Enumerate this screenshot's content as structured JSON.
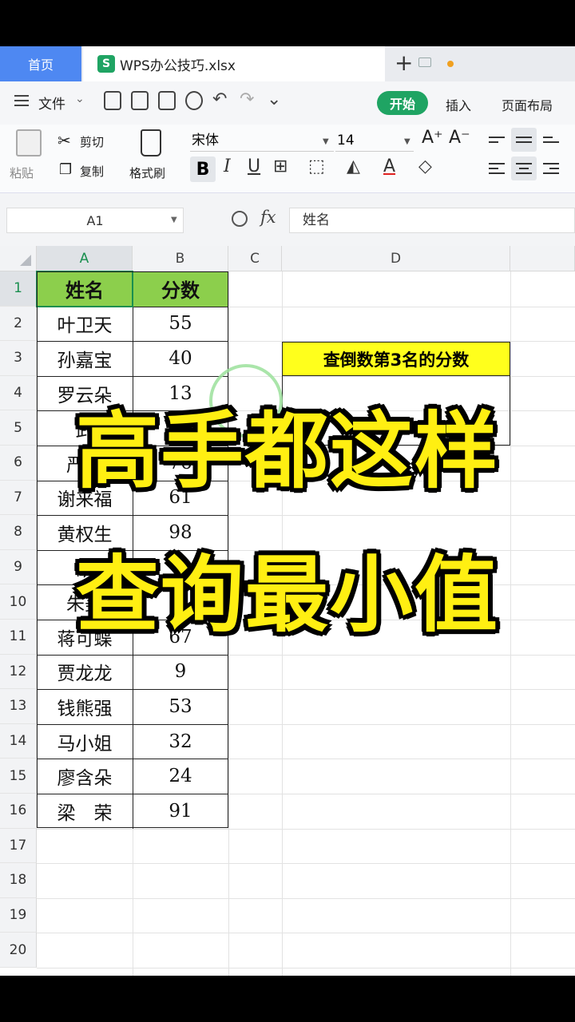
{
  "tabs": {
    "home": "首页",
    "file_icon": "S",
    "file_name": "WPS办公技巧.xlsx",
    "new_tab": "+"
  },
  "menu": {
    "file": "文件",
    "start": "开始",
    "insert": "插入",
    "page_layout": "页面布局"
  },
  "ribbon": {
    "paste": "粘贴",
    "cut": "剪切",
    "copy": "复制",
    "format_painter": "格式刷",
    "font": "宋体",
    "font_size": "14",
    "bold": "B",
    "italic": "I",
    "underline": "U",
    "grow": "A⁺",
    "shrink": "A⁻"
  },
  "formula_bar": {
    "cell_ref": "A1",
    "fx": "fx",
    "content": "姓名"
  },
  "columns": [
    "A",
    "B",
    "C",
    "D"
  ],
  "rows": [
    "1",
    "2",
    "3",
    "4",
    "5",
    "6",
    "7",
    "8",
    "9",
    "10",
    "11",
    "12",
    "13",
    "14",
    "15",
    "16",
    "17",
    "18",
    "19",
    "20"
  ],
  "table": {
    "header": {
      "name": "姓名",
      "score": "分数"
    },
    "data": [
      {
        "name": "叶卫天",
        "score": "55"
      },
      {
        "name": "孙嘉宝",
        "score": "40"
      },
      {
        "name": "罗云朵",
        "score": "13"
      },
      {
        "name": "武",
        "score": ""
      },
      {
        "name": "严丽",
        "score": "76"
      },
      {
        "name": "谢来福",
        "score": "61"
      },
      {
        "name": "黄权生",
        "score": "98"
      },
      {
        "name": "胡",
        "score": ""
      },
      {
        "name": "朱美",
        "score": ""
      },
      {
        "name": "蒋可蝶",
        "score": "67"
      },
      {
        "name": "贾龙龙",
        "score": "9"
      },
      {
        "name": "钱熊强",
        "score": "53"
      },
      {
        "name": "马小姐",
        "score": "32"
      },
      {
        "name": "廖含朵",
        "score": "24"
      },
      {
        "name": "梁　荣",
        "score": "91"
      }
    ]
  },
  "query_label": "查倒数第3名的分数",
  "overlay": {
    "line1": "高手都这样",
    "line2": "查询最小值"
  },
  "colors": {
    "header_green": "#8ccf4c",
    "query_yellow": "#ffff1c",
    "overlay_yellow": "#ffef12",
    "wps_green": "#1fa463",
    "home_tab_blue": "#4e88f2"
  }
}
